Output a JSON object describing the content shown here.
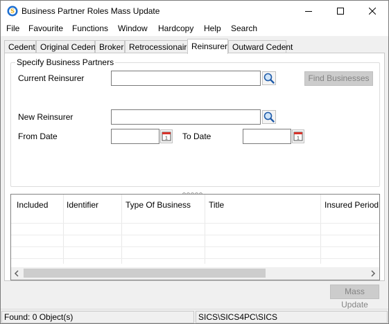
{
  "window": {
    "title": "Business Partner Roles Mass Update"
  },
  "menu": [
    "File",
    "Favourite",
    "Functions",
    "Window",
    "Hardcopy",
    "Help",
    "Search"
  ],
  "tabs": [
    {
      "label": "Cedent",
      "active": false
    },
    {
      "label": "Original Cedent",
      "active": false
    },
    {
      "label": "Broker",
      "active": false
    },
    {
      "label": "Retrocessionaire",
      "active": false
    },
    {
      "label": "Reinsurer",
      "active": true
    },
    {
      "label": "Outward Cedent",
      "active": false
    }
  ],
  "form": {
    "group_title": "Specify Business Partners",
    "current_reinsurer_label": "Current Reinsurer",
    "current_reinsurer_value": "",
    "find_button": "Find Businesses",
    "new_reinsurer_label": "New Reinsurer",
    "new_reinsurer_value": "",
    "from_date_label": "From Date",
    "from_date_value": "",
    "to_date_label": "To Date",
    "to_date_value": ""
  },
  "grid": {
    "columns": [
      "Included",
      "Identifier",
      "Type Of Business",
      "Title",
      "Insured Period"
    ],
    "rows": []
  },
  "actions": {
    "mass_update": "Mass Update"
  },
  "status": {
    "found": "Found: 0 Object(s)",
    "path": "SICS\\SICS4PC\\SICS"
  },
  "colors": {
    "accent": "#1e6fd0",
    "disabled_button": "#cccccc",
    "calendar_red": "#d9342b"
  },
  "icons": [
    "app-icon",
    "minimize-icon",
    "maximize-icon",
    "close-icon",
    "search-icon",
    "calendar-icon",
    "chevron-left-icon",
    "chevron-right-icon"
  ]
}
